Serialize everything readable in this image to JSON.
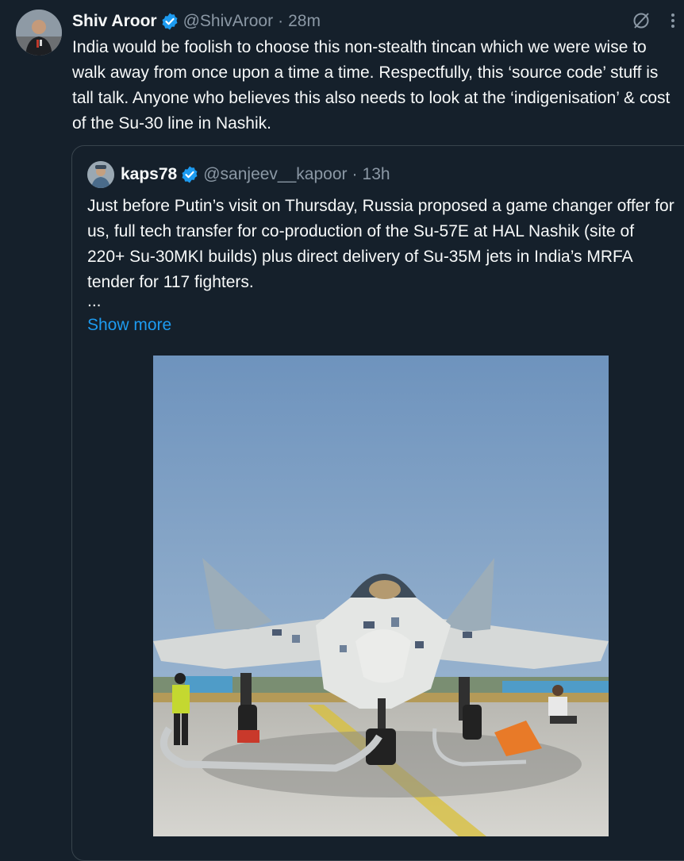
{
  "tweet": {
    "author_name": "Shiv Aroor",
    "handle": "@ShivAroor",
    "separator": "·",
    "time": "28m",
    "text": "India would be foolish to choose this non-stealth tincan which we were wise to walk away from once upon a time a time. Respectfully, this ‘source code’ stuff is tall talk. Anyone who believes this also needs to look at the ‘indigenisation’ & cost of the Su-30 line in Nashik."
  },
  "quote": {
    "author_name": "kaps78",
    "handle": "@sanjeev__kapoor",
    "separator": "·",
    "time": "13h",
    "text": "Just before Putin’s visit on Thursday, Russia proposed a game changer offer for us, full tech transfer for co-production of the Su-57E at HAL Nashik (site of 220+ Su-30MKI builds) plus direct delivery of Su-35M jets in India’s MRFA tender for 117 fighters.",
    "ellipsis": "...",
    "show_more": "Show more"
  },
  "icons": {
    "verified": "verified-badge-icon",
    "grok": "grok-icon",
    "more": "more-options-icon"
  },
  "colors": {
    "background": "#15202b",
    "text": "#f7f9f9",
    "muted": "#8b98a5",
    "link": "#1d9bf0",
    "verified": "#1d9bf0",
    "border": "#38444d"
  }
}
